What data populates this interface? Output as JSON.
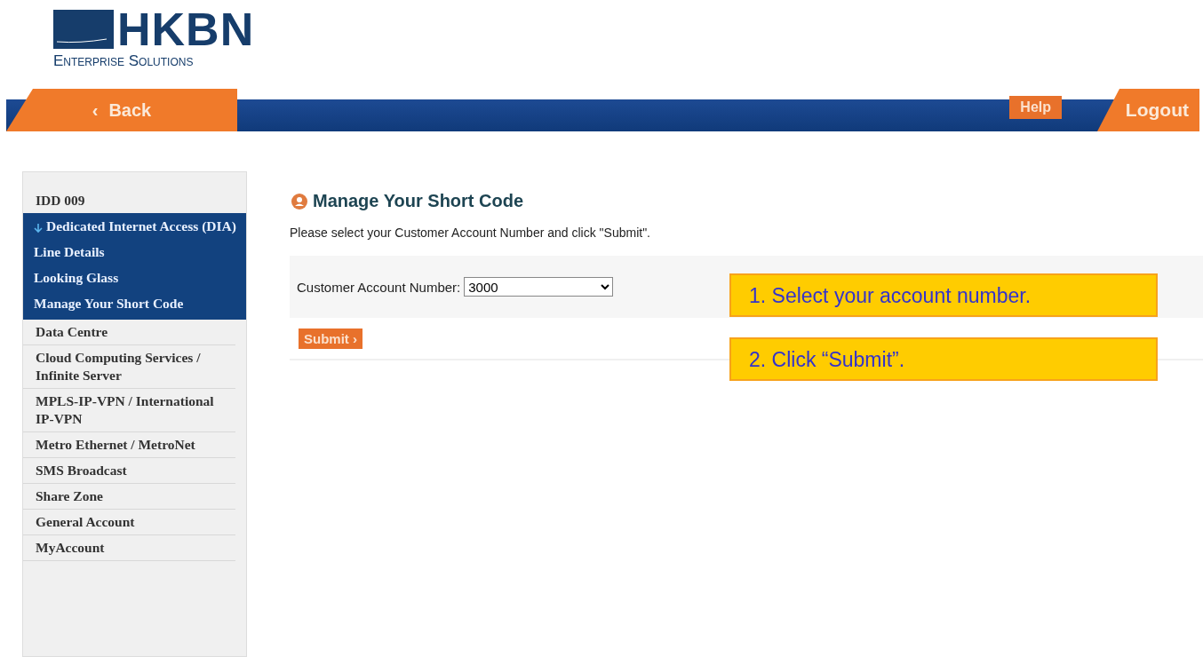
{
  "logo": {
    "wordmark": "HKBN",
    "tagline": "Enterprise Solutions"
  },
  "nav": {
    "back": "Back",
    "back_glyph": "‹",
    "help": "Help",
    "logout": "Logout"
  },
  "sidebar": {
    "items": [
      {
        "label": "IDD 009",
        "expanded": false
      },
      {
        "label": "Dedicated Internet Access (DIA)",
        "expanded": true,
        "children": [
          {
            "label": "Line Details"
          },
          {
            "label": "Looking Glass"
          },
          {
            "label": "Manage Your Short Code"
          }
        ]
      },
      {
        "label": "Data Centre",
        "expanded": false
      },
      {
        "label": "Cloud Computing Services / Infinite Server",
        "expanded": false
      },
      {
        "label": "MPLS-IP-VPN / International IP-VPN",
        "expanded": false
      },
      {
        "label": "Metro Ethernet / MetroNet",
        "expanded": false
      },
      {
        "label": "SMS Broadcast",
        "expanded": false
      },
      {
        "label": "Share Zone",
        "expanded": false
      },
      {
        "label": "General Account",
        "expanded": false
      },
      {
        "label": "MyAccount",
        "expanded": false
      }
    ]
  },
  "page": {
    "title": "Manage Your Short Code",
    "instruction": "Please select your Customer Account Number and click \"Submit\".",
    "account_label": "Customer Account Number:",
    "account_value": "3000",
    "submit": "Submit",
    "submit_glyph": "›"
  },
  "callouts": [
    "1. Select your account number.",
    "2. Click “Submit”."
  ]
}
